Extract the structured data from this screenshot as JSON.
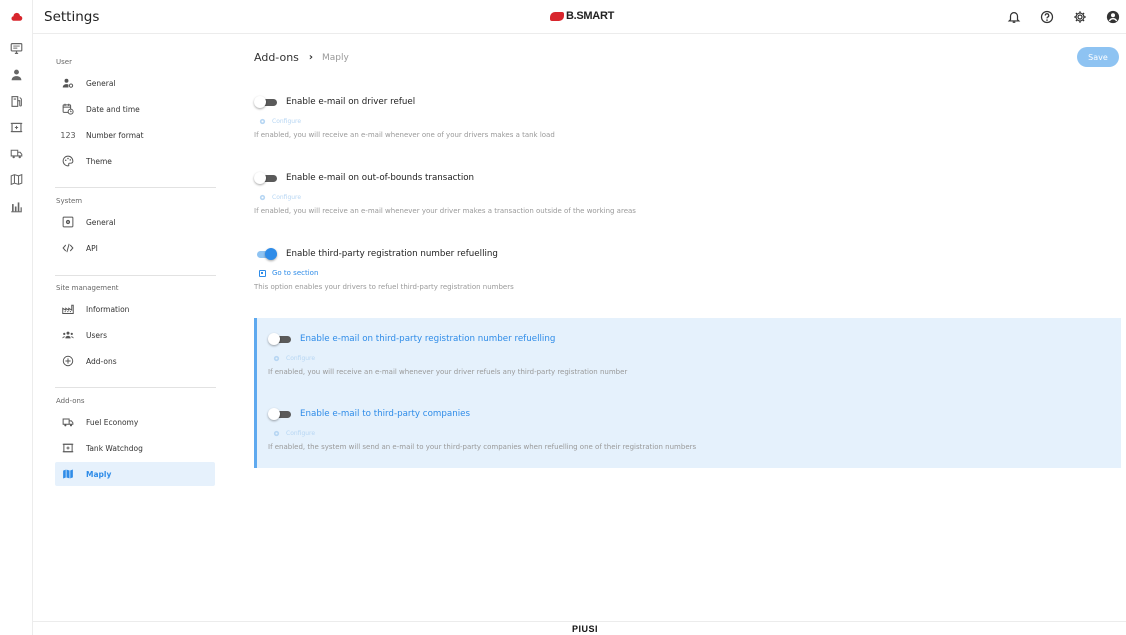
{
  "app": {
    "title": "Settings",
    "brand": "B.SMART",
    "footer_brand": "PIUSI"
  },
  "rail": {
    "icons": [
      "cloud-icon",
      "monitor-icon",
      "user-icon",
      "fuel-pump-icon",
      "tank-icon",
      "truck-icon",
      "map-icon",
      "bar-chart-icon"
    ]
  },
  "topbar": {
    "icons": [
      "bell-icon",
      "help-icon",
      "gear-icon",
      "account-icon"
    ]
  },
  "sidebar": {
    "sections": [
      {
        "title": "User",
        "items": [
          {
            "label": "General",
            "icon": "user-gear-icon"
          },
          {
            "label": "Date and time",
            "icon": "calendar-clock-icon"
          },
          {
            "label": "Number format",
            "icon": "numbers-icon",
            "glyph": "123"
          },
          {
            "label": "Theme",
            "icon": "palette-icon"
          }
        ]
      },
      {
        "title": "System",
        "items": [
          {
            "label": "General",
            "icon": "system-gear-icon"
          },
          {
            "label": "API",
            "icon": "code-icon"
          }
        ]
      },
      {
        "title": "Site management",
        "items": [
          {
            "label": "Information",
            "icon": "factory-icon"
          },
          {
            "label": "Users",
            "icon": "users-icon"
          },
          {
            "label": "Add-ons",
            "icon": "plus-circle-icon"
          }
        ]
      },
      {
        "title": "Add-ons",
        "items": [
          {
            "label": "Fuel Economy",
            "icon": "truck-icon"
          },
          {
            "label": "Tank Watchdog",
            "icon": "tank-icon"
          },
          {
            "label": "Maply",
            "icon": "map-icon",
            "active": true
          }
        ]
      }
    ]
  },
  "breadcrumb": {
    "parent": "Add-ons",
    "separator": "›",
    "current": "Maply"
  },
  "save_label": "Save",
  "configure_label": "Configure",
  "go_to_section_label": "Go to section",
  "options": [
    {
      "label": "Enable e-mail on driver refuel",
      "enabled": false,
      "description": "If enabled, you will receive an e-mail whenever one of your drivers makes a tank load"
    },
    {
      "label": "Enable e-mail on out-of-bounds transaction",
      "enabled": false,
      "description": "If enabled, you will receive an e-mail whenever your driver makes a transaction outside of the working areas"
    },
    {
      "label": "Enable third-party registration number refuelling",
      "enabled": true,
      "description": "This option enables your drivers to refuel third-party registration numbers"
    }
  ],
  "sub_options": [
    {
      "label": "Enable e-mail on third-party registration number refuelling",
      "enabled": false,
      "description": "If enabled, you will receive an e-mail whenever your driver refuels any third-party registration number"
    },
    {
      "label": "Enable e-mail to third-party companies",
      "enabled": false,
      "description": "If enabled, the system will send an e-mail to your third-party companies when refuelling one of their registration numbers"
    }
  ],
  "colors": {
    "accent": "#2f8ce8",
    "panel": "#e5f1fc",
    "brand_red": "#d8262d"
  }
}
